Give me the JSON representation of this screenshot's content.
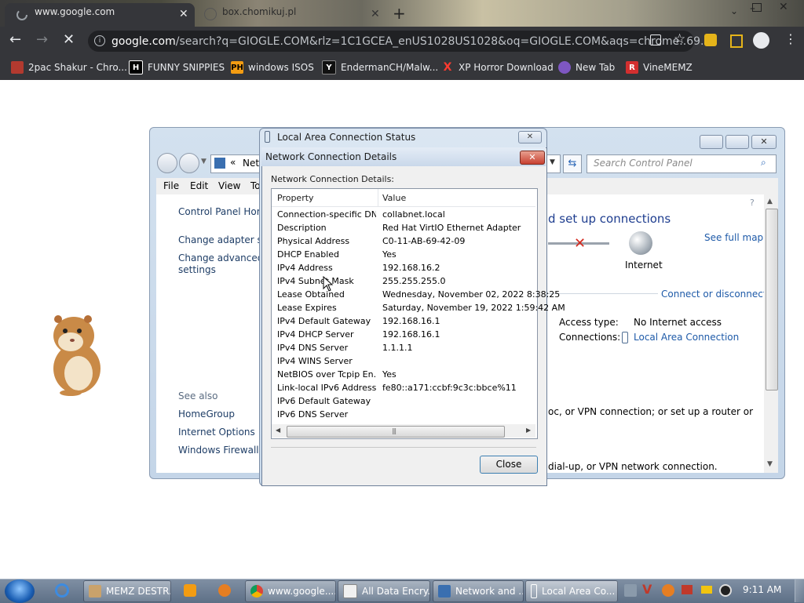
{
  "browser": {
    "tabs": [
      {
        "title": "www.google.com",
        "state": "loading"
      },
      {
        "title": "box.chomikuj.pl"
      }
    ],
    "url_host": "google.com",
    "url_rest": "/search?q=GIOGLE.COM&rlz=1C1GCEA_enUS1028US1028&oq=GIOGLE.COM&aqs=chrome..69...",
    "bookmarks": [
      {
        "label": "2pac Shakur - Chro..."
      },
      {
        "label": "FUNNY SNIPPIES"
      },
      {
        "label": "windows ISOS"
      },
      {
        "label": "EndermanCH/Malw..."
      },
      {
        "label": "XP Horror Download"
      },
      {
        "label": "New Tab"
      },
      {
        "label": "VineMEMZ"
      }
    ]
  },
  "control_panel": {
    "address_prefix": "«",
    "address_text": "Net",
    "search_placeholder": "Search Control Panel",
    "menu": [
      "File",
      "Edit",
      "View",
      "To"
    ],
    "left_links": [
      "Control Panel Hom",
      "Change adapter set",
      "Change advanced s",
      "settings"
    ],
    "see_also_label": "See also",
    "see_also": [
      "HomeGroup",
      "Internet Options",
      "Windows Firewall"
    ],
    "heading": "d set up connections",
    "see_full_map": "See full map",
    "internet_label": "Internet",
    "connect_disconnect": "Connect or disconnect",
    "access_type_label": "Access type:",
    "access_type_value": "No Internet access",
    "connections_label": "Connections:",
    "connections_value": "Local Area Connection",
    "text1": "oc, or VPN connection; or set up a router or",
    "text2": "dial-up, or VPN network connection."
  },
  "lac_status": {
    "title": "Local Area Connection Status"
  },
  "details_dialog": {
    "title": "Network Connection Details",
    "label": "Network Connection Details:",
    "close_glyph": "✕",
    "columns": [
      "Property",
      "Value"
    ],
    "rows": [
      {
        "property": "Connection-specific DN...",
        "value": "collabnet.local"
      },
      {
        "property": "Description",
        "value": "Red Hat VirtIO Ethernet Adapter"
      },
      {
        "property": "Physical Address",
        "value": "C0-11-AB-69-42-09"
      },
      {
        "property": "DHCP Enabled",
        "value": "Yes"
      },
      {
        "property": "IPv4 Address",
        "value": "192.168.16.2"
      },
      {
        "property": "IPv4 Subnet Mask",
        "value": "255.255.255.0"
      },
      {
        "property": "Lease Obtained",
        "value": "Wednesday, November 02, 2022 8:38:25"
      },
      {
        "property": "Lease Expires",
        "value": "Saturday, November 19, 2022 1:59:42 AM"
      },
      {
        "property": "IPv4 Default Gateway",
        "value": "192.168.16.1"
      },
      {
        "property": "IPv4 DHCP Server",
        "value": "192.168.16.1"
      },
      {
        "property": "IPv4 DNS Server",
        "value": "1.1.1.1"
      },
      {
        "property": "IPv4 WINS Server",
        "value": ""
      },
      {
        "property": "NetBIOS over Tcpip En...",
        "value": "Yes"
      },
      {
        "property": "Link-local IPv6 Address",
        "value": "fe80::a171:ccbf:9c3c:bbce%11"
      },
      {
        "property": "IPv6 Default Gateway",
        "value": ""
      },
      {
        "property": "IPv6 DNS Server",
        "value": ""
      }
    ],
    "close_button": "Close"
  },
  "taskbar": {
    "items": [
      {
        "label": "MEMZ DESTR..."
      },
      {
        "label": "www.google...."
      },
      {
        "label": "All Data Encry..."
      },
      {
        "label": "Network and ..."
      },
      {
        "label": "Local Area Co..."
      }
    ],
    "clock": "9:11 AM"
  }
}
